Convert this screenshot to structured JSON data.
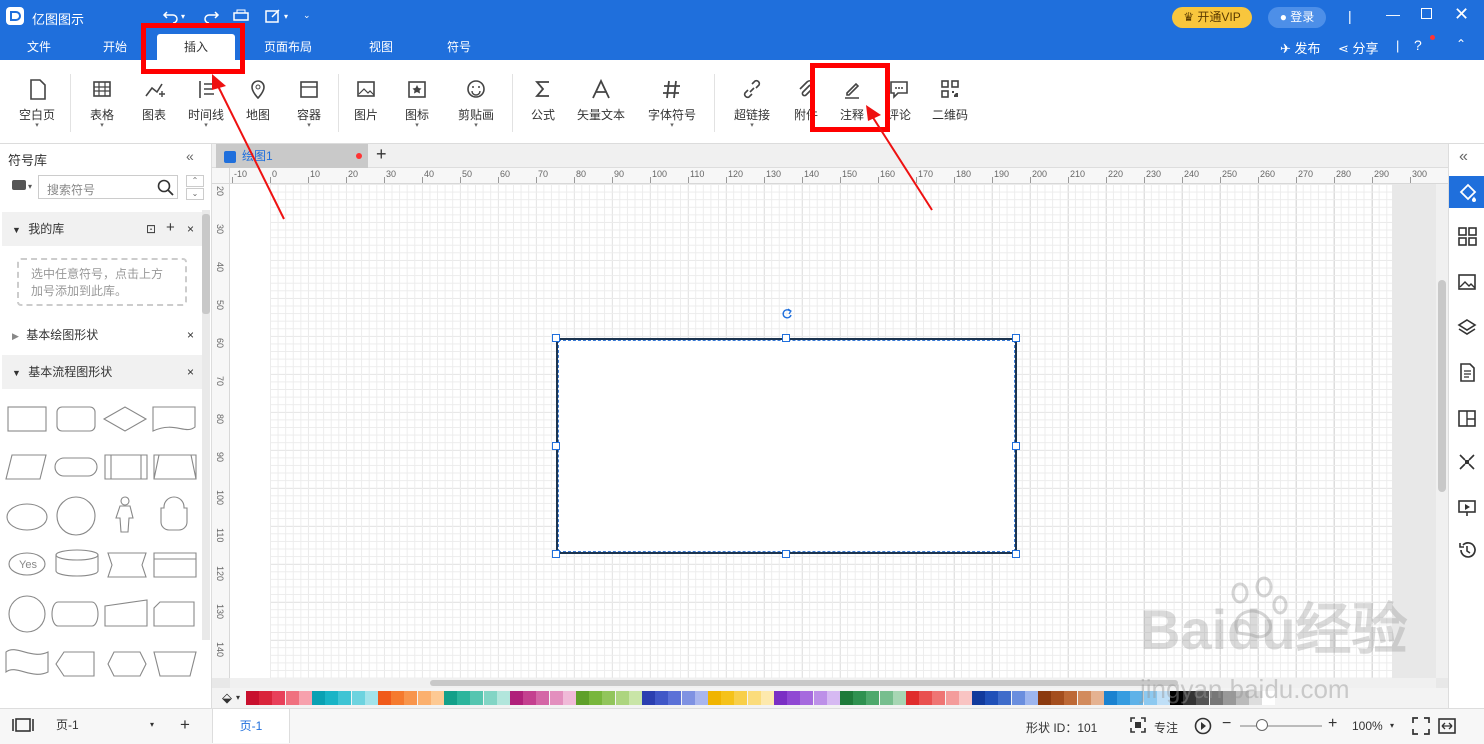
{
  "app": {
    "title": "亿图图示",
    "vip": "开通VIP",
    "login": "登录",
    "publish": "发布",
    "share": "分享"
  },
  "tabs": [
    {
      "label": "文件"
    },
    {
      "label": "开始"
    },
    {
      "label": "插入"
    },
    {
      "label": "页面布局"
    },
    {
      "label": "视图"
    },
    {
      "label": "符号"
    }
  ],
  "ribbon": [
    {
      "label": "空白页"
    },
    {
      "label": "表格"
    },
    {
      "label": "图表"
    },
    {
      "label": "时间线"
    },
    {
      "label": "地图"
    },
    {
      "label": "容器"
    },
    {
      "label": "图片"
    },
    {
      "label": "图标"
    },
    {
      "label": "剪贴画"
    },
    {
      "label": "公式"
    },
    {
      "label": "矢量文本"
    },
    {
      "label": "字体符号"
    },
    {
      "label": "超链接"
    },
    {
      "label": "附件"
    },
    {
      "label": "注释"
    },
    {
      "label": "评论"
    },
    {
      "label": "二维码"
    }
  ],
  "left": {
    "title": "符号库",
    "search_placeholder": "搜索符号",
    "mylib": "我的库",
    "mylib_hint": "选中任意符号，点击上方加号添加到此库。",
    "basic_shapes": "基本绘图形状",
    "flow_shapes": "基本流程图形状",
    "yes_label": "Yes"
  },
  "doc": {
    "tab": "绘图1"
  },
  "ruler_h": [
    "-10",
    "0",
    "10",
    "20",
    "30",
    "40",
    "50",
    "60",
    "70",
    "80",
    "90",
    "100",
    "110",
    "120",
    "130",
    "140",
    "150",
    "160",
    "170",
    "180",
    "190",
    "200",
    "210",
    "220",
    "230",
    "240",
    "250",
    "260",
    "270",
    "280",
    "290",
    "300"
  ],
  "ruler_v": [
    "20",
    "30",
    "40",
    "50",
    "60",
    "70",
    "80",
    "90",
    "100",
    "110",
    "120",
    "130",
    "140"
  ],
  "status": {
    "page_sel": "页-1",
    "page_tab": "页-1",
    "shape_id": "形状 ID：101",
    "focus": "专注",
    "zoom": "100%"
  },
  "watermark": {
    "brand": "Baidu经验",
    "url": "jingyan.baidu.com"
  },
  "palette": [
    "#c8102e",
    "#d9243b",
    "#e8405a",
    "#f0707f",
    "#f7a1ad",
    "#0aa1b3",
    "#19b4c6",
    "#3fc4d4",
    "#6dd3df",
    "#a3e3ea",
    "#f05a1a",
    "#f57a2e",
    "#f8954c",
    "#fbb06e",
    "#fdc993",
    "#13a089",
    "#2cb59c",
    "#55c5b0",
    "#82d5c5",
    "#b2e6dc",
    "#b0207a",
    "#c4408f",
    "#d466a6",
    "#e38fbe",
    "#f0bad8",
    "#5fa02a",
    "#78b63c",
    "#92c55c",
    "#add57f",
    "#c9e5a7",
    "#2b3fb0",
    "#4057c7",
    "#5b71d7",
    "#7f92e2",
    "#a9b6ee",
    "#f0b400",
    "#f5c21a",
    "#f8cf4a",
    "#fbdc7c",
    "#fde9ad",
    "#7b2fc4",
    "#9048d3",
    "#a66ade",
    "#bd90e8",
    "#d6b9f2",
    "#1e7a3a",
    "#2f9150",
    "#4ea86c",
    "#77be8e",
    "#a7d6b4",
    "#e02c2c",
    "#e9504f",
    "#ef7574",
    "#f49c9b",
    "#f9c4c3",
    "#123a9c",
    "#2050b8",
    "#3f6cca",
    "#6a8ede",
    "#9db5ee",
    "#8b3a0f",
    "#a44e1e",
    "#bd6936",
    "#d28b5d",
    "#e5b291",
    "#1a82d0",
    "#369ce0",
    "#5fb2e8",
    "#8dc9f0",
    "#bfdff7",
    "#000000",
    "#333333",
    "#555555",
    "#777777",
    "#999999",
    "#bbbbbb",
    "#dddddd",
    "#ffffff"
  ]
}
